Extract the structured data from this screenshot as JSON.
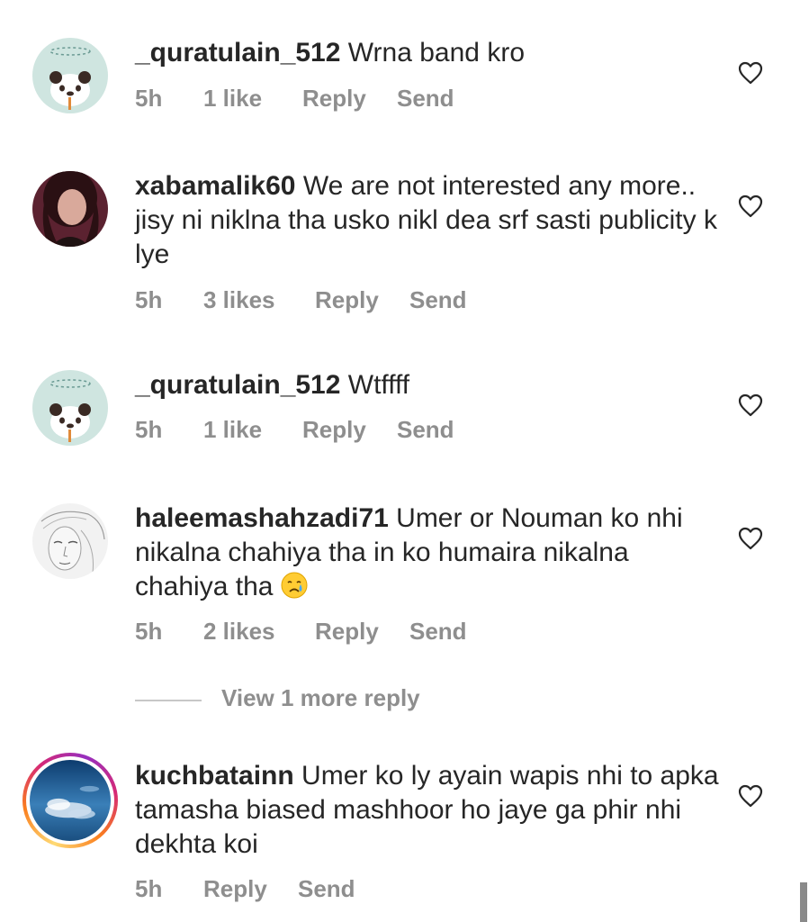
{
  "comments": [
    {
      "username": "_quratulain_512",
      "text": "Wrna band kro",
      "time": "5h",
      "likes": "1 like",
      "reply": "Reply",
      "send": "Send"
    },
    {
      "username": "xabamalik60",
      "text": "We are not interested any more.. jisy ni niklna tha usko nikl dea srf sasti publicity k lye",
      "time": "5h",
      "likes": "3 likes",
      "reply": "Reply",
      "send": "Send"
    },
    {
      "username": "_quratulain_512",
      "text": "Wtffff",
      "time": "5h",
      "likes": "1 like",
      "reply": "Reply",
      "send": "Send"
    },
    {
      "username": "haleemashahzadi71",
      "text": "Umer or Nouman ko nhi nikalna chahiya tha in ko humaira nikalna chahiya tha",
      "emoji": "crying-face",
      "time": "5h",
      "likes": "2 likes",
      "reply": "Reply",
      "send": "Send"
    },
    {
      "username": "kuchbatainn",
      "text": "Umer ko ly ayain wapis nhi to apka tamasha biased mashhoor ho jaye ga phir nhi dekhta koi",
      "time": "5h",
      "reply": "Reply",
      "send": "Send",
      "has_story_ring": true
    }
  ],
  "view_more_replies": "View 1 more reply",
  "icons": {
    "like": "heart-outline-icon"
  },
  "colors": {
    "text": "#262626",
    "meta": "#8e8e8e",
    "divider": "#c7c7c7"
  }
}
